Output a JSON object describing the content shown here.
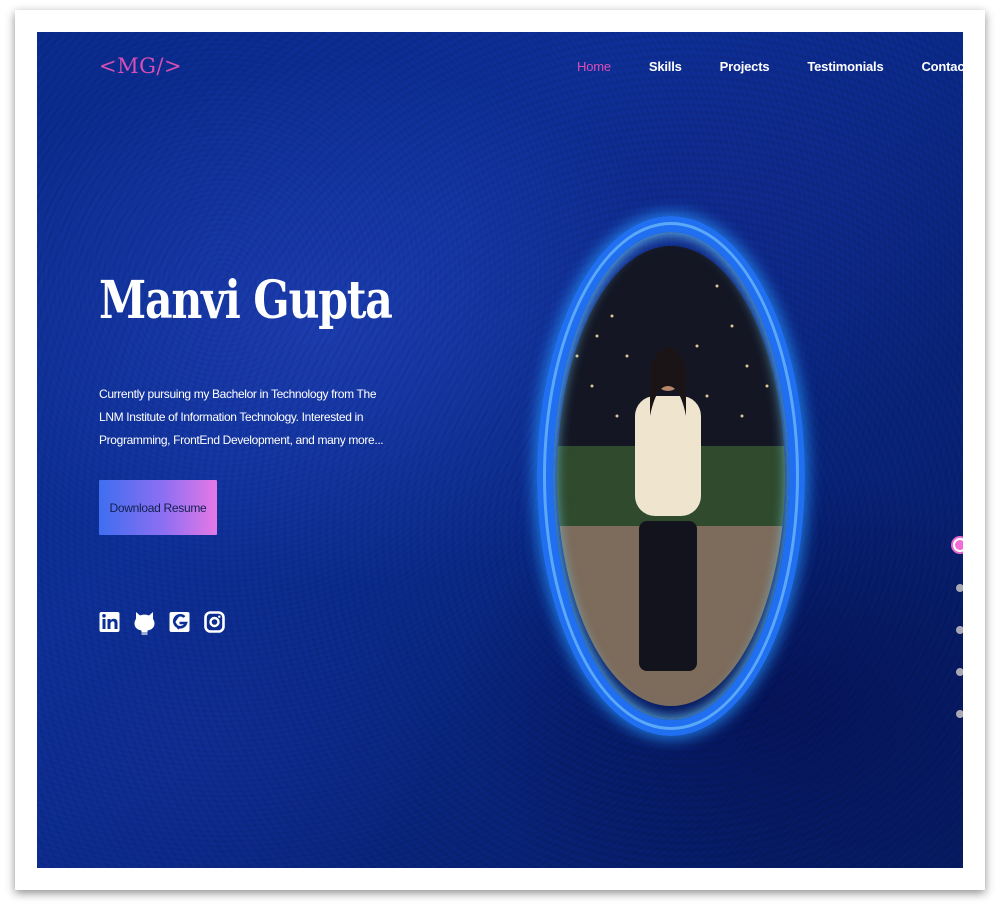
{
  "logo": "<MG/>",
  "nav": {
    "items": [
      "Home",
      "Skills",
      "Projects",
      "Testimonials",
      "Contact"
    ],
    "active": "Home"
  },
  "hero": {
    "name": "Manvi Gupta",
    "description": "Currently pursuing my Bachelor in Technology from The LNM Institute of Information Technology. Interested in Programming, FrontEnd Development, and many more...",
    "resume_button": "Download Resume",
    "social_icons": [
      "linkedin-icon",
      "github-icon",
      "geeksforgeeks-icon",
      "instagram-icon"
    ]
  },
  "section_dots": {
    "count": 5,
    "active_index": 0
  },
  "colors": {
    "accent": "#d94fb6",
    "background": "#0c2f96",
    "ring": "#1f6ff0",
    "button_start": "#3f6ef0",
    "button_end": "#e678e6"
  }
}
